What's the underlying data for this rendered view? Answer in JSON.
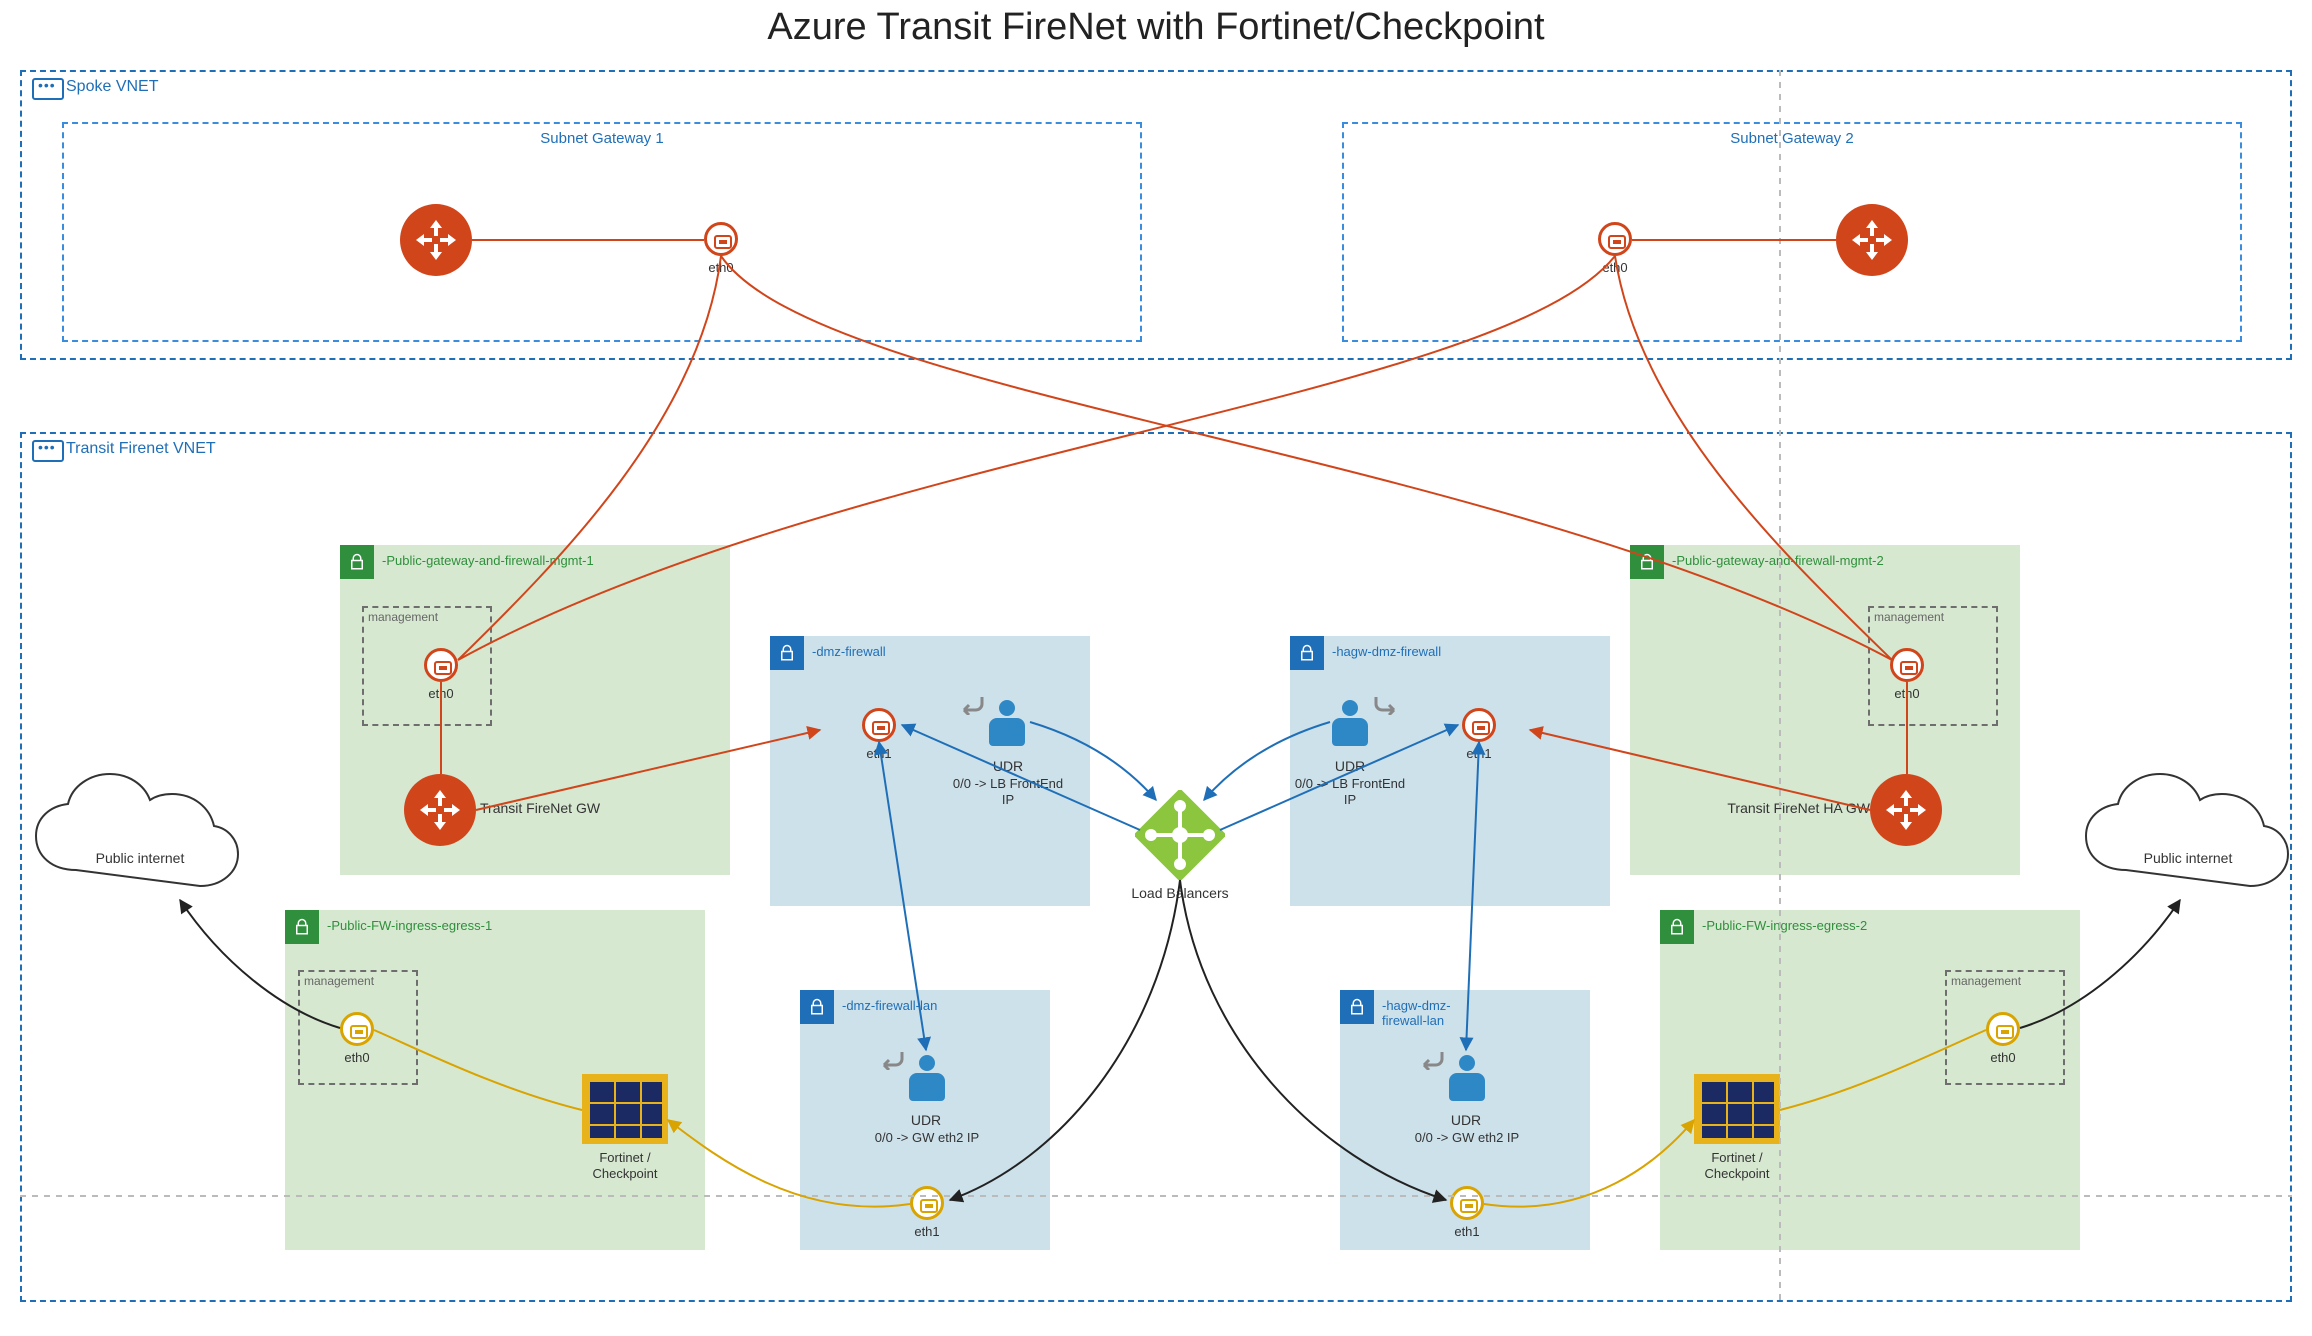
{
  "title": "Azure Transit FireNet with Fortinet/Checkpoint",
  "spoke_vnet": {
    "label": "Spoke VNET",
    "subnet1": {
      "label": "Subnet Gateway 1",
      "eth": "eth0"
    },
    "subnet2": {
      "label": "Subnet Gateway 2",
      "eth": "eth0"
    }
  },
  "transit_vnet": {
    "label": "Transit Firenet VNET",
    "sg1": {
      "label": "-Public-gateway-and-firewall-mgmt-1",
      "mgmt": "management",
      "eth": "eth0",
      "gw_label": "Transit FireNet GW"
    },
    "sg2": {
      "label": "-Public-gateway-and-firewall-mgmt-2",
      "mgmt": "management",
      "eth": "eth0",
      "gw_label": "Transit FireNet HA GW"
    },
    "fwbox1": {
      "label": "-dmz-firewall",
      "udr_title": "UDR",
      "udr_text": "0/0 -> LB FrontEnd IP",
      "eth": "eth1"
    },
    "fwbox2": {
      "label": "-hagw-dmz-firewall",
      "udr_title": "UDR",
      "udr_text": "0/0 -> LB FrontEnd IP",
      "eth": "eth1"
    },
    "lanbox1": {
      "label": "-dmz-firewall-lan",
      "udr_title": "UDR",
      "udr_text": "0/0 -> GW eth2 IP",
      "eth": "eth1"
    },
    "lanbox2": {
      "label": "-hagw-dmz-firewall-lan",
      "udr_title": "UDR",
      "udr_text": "0/0 -> GW eth2 IP",
      "eth": "eth1"
    },
    "lb_label": "Load Balancers",
    "ingress1": {
      "label": "-Public-FW-ingress-egress-1",
      "mgmt": "management",
      "eth": "eth0",
      "fw_label": "Fortinet / Checkpoint"
    },
    "ingress2": {
      "label": "-Public-FW-ingress-egress-2",
      "mgmt": "management",
      "eth": "eth0",
      "fw_label": "Fortinet / Checkpoint"
    }
  },
  "internet_left": "Public internet",
  "internet_right": "Public internet"
}
